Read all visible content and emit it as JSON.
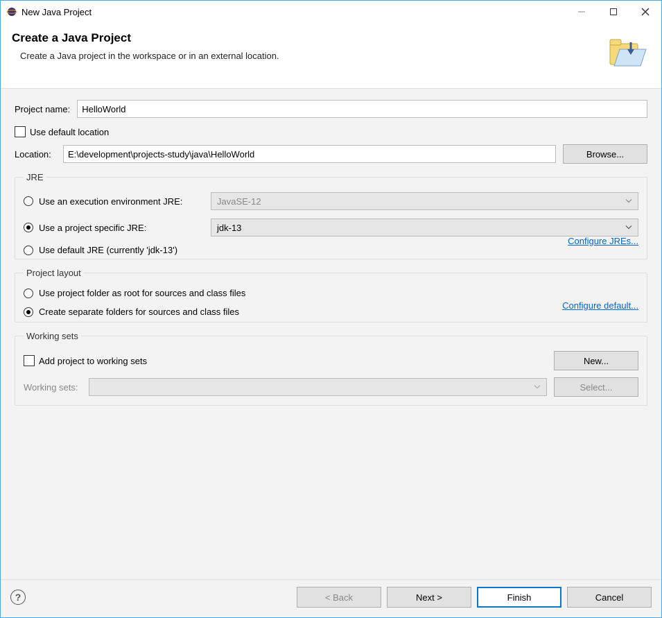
{
  "window": {
    "title": "New Java Project"
  },
  "banner": {
    "heading": "Create a Java Project",
    "subheading": "Create a Java project in the workspace or in an external location."
  },
  "projectName": {
    "label": "Project name:",
    "value": "HelloWorld"
  },
  "location": {
    "useDefaultLabel": "Use default location",
    "useDefaultChecked": false,
    "label": "Location:",
    "value": "E:\\development\\projects-study\\java\\HelloWorld",
    "browse": "Browse..."
  },
  "jre": {
    "legend": "JRE",
    "opt1": {
      "label": "Use an execution environment JRE:",
      "selected": false,
      "value": "JavaSE-12"
    },
    "opt2": {
      "label": "Use a project specific JRE:",
      "selected": true,
      "value": "jdk-13"
    },
    "opt3": {
      "label": "Use default JRE (currently 'jdk-13')",
      "selected": false
    },
    "configureLink": "Configure JREs..."
  },
  "layout": {
    "legend": "Project layout",
    "opt1": {
      "label": "Use project folder as root for sources and class files",
      "selected": false
    },
    "opt2": {
      "label": "Create separate folders for sources and class files",
      "selected": true
    },
    "configureLink": "Configure default..."
  },
  "workingSets": {
    "legend": "Working sets",
    "addLabel": "Add project to working sets",
    "addChecked": false,
    "newBtn": "New...",
    "wsLabel": "Working sets:",
    "wsValue": "",
    "selectBtn": "Select..."
  },
  "footer": {
    "back": "< Back",
    "next": "Next >",
    "finish": "Finish",
    "cancel": "Cancel"
  }
}
